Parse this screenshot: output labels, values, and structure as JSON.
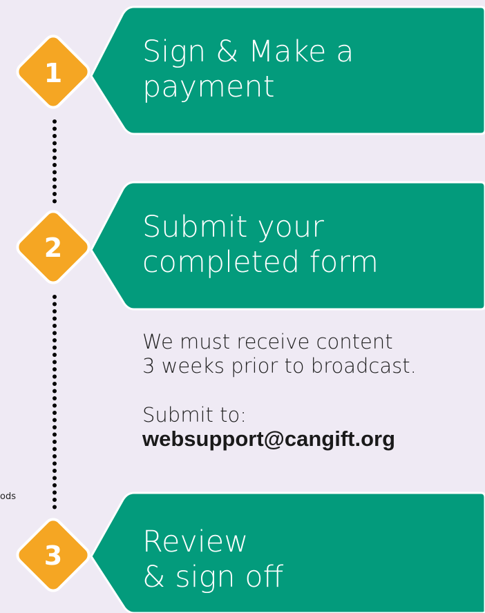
{
  "colors": {
    "background": "#efeaf4",
    "card": "#039b7c",
    "badge": "#f5a623",
    "badge_border": "#ffffff",
    "connector": "#000000"
  },
  "steps": [
    {
      "number": "1",
      "title_lines": [
        "Sign & Make a",
        "payment"
      ]
    },
    {
      "number": "2",
      "title_lines": [
        "Submit your",
        "completed form"
      ]
    },
    {
      "number": "3",
      "title_lines": [
        "Review",
        "& sign off"
      ]
    }
  ],
  "note": {
    "lines": [
      "We must receive content",
      "3 weeks prior to broadcast."
    ],
    "submit_label": "Submit to:",
    "email": "websupport@cangift.org"
  },
  "edge_fragment": "ods"
}
